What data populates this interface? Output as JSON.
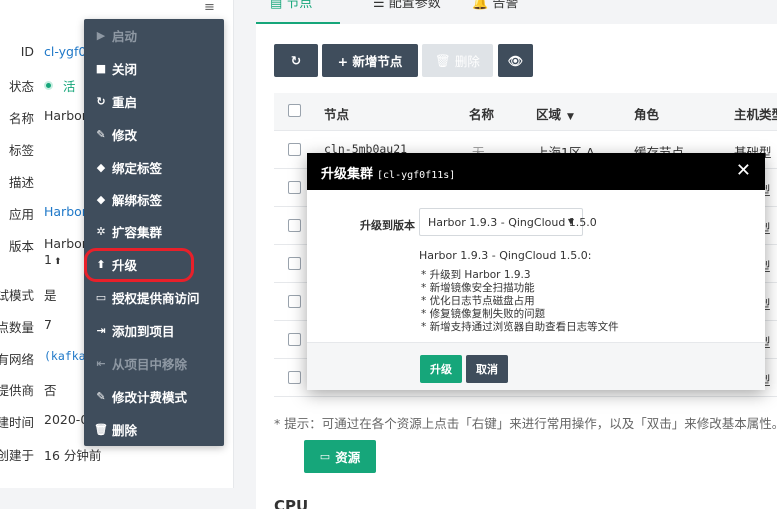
{
  "left_panel": {
    "menu_toggle": "≡",
    "rows": [
      {
        "label": "ID",
        "value": "cl-ygf0"
      },
      {
        "label": "状态",
        "value": "活"
      },
      {
        "label": "名称",
        "value": "Harbor"
      },
      {
        "label": "标签",
        "value": ""
      },
      {
        "label": "描述",
        "value": ""
      },
      {
        "label": "应用",
        "value": "Harbor"
      },
      {
        "label": "版本",
        "value": "Harbor",
        "value2": "1"
      },
      {
        "label": "试模式",
        "value": "是"
      },
      {
        "label": "点数量",
        "value": "7"
      },
      {
        "label": "有网络",
        "value": "(kafka"
      },
      {
        "label": "提供商",
        "value": "否"
      },
      {
        "label": "建时间",
        "value": "2020-0"
      },
      {
        "label": "创建于",
        "value": "16 分钟前"
      }
    ]
  },
  "context_menu": {
    "items": [
      {
        "label": "启动",
        "icon": "play-icon",
        "glyph": "▶",
        "disabled": true
      },
      {
        "label": "关闭",
        "icon": "stop-icon",
        "glyph": "■",
        "disabled": false
      },
      {
        "label": "重启",
        "icon": "restart-icon",
        "glyph": "↻",
        "disabled": false
      },
      {
        "label": "修改",
        "icon": "pencil-icon",
        "glyph": "✎",
        "disabled": false
      },
      {
        "label": "绑定标签",
        "icon": "tag-icon",
        "glyph": "◆",
        "disabled": false
      },
      {
        "label": "解绑标签",
        "icon": "tag-icon",
        "glyph": "◆",
        "disabled": false
      },
      {
        "label": "扩容集群",
        "icon": "gear-icon",
        "glyph": "✲",
        "disabled": false
      },
      {
        "label": "升级",
        "icon": "arrow-up-icon",
        "glyph": "⬆",
        "disabled": false
      },
      {
        "label": "授权提供商访问",
        "icon": "monitor-icon",
        "glyph": "▭",
        "disabled": false
      },
      {
        "label": "添加到项目",
        "icon": "sign-in-icon",
        "glyph": "⇥",
        "disabled": false
      },
      {
        "label": "从项目中移除",
        "icon": "sign-out-icon",
        "glyph": "⇤",
        "disabled": true
      },
      {
        "label": "修改计费模式",
        "icon": "pencil-icon",
        "glyph": "✎",
        "disabled": false
      },
      {
        "label": "删除",
        "icon": "trash-icon",
        "glyph": "🗑",
        "disabled": false
      }
    ]
  },
  "tabs": [
    {
      "label": "节点",
      "icon": "server-icon",
      "active": true
    },
    {
      "label": "配置参数",
      "icon": "list-icon",
      "active": false
    },
    {
      "label": "告警",
      "icon": "bell-icon",
      "active": false
    }
  ],
  "toolbar": {
    "refresh_glyph": "↻",
    "add_node_label": "+ 新增节点",
    "delete_label": "删除",
    "view_glyph": "👁"
  },
  "table": {
    "headers": [
      "节点",
      "名称",
      "区域",
      "角色",
      "主机类型"
    ],
    "rows": [
      {
        "node": "cln-5mb0au21",
        "name": "无",
        "zone": "上海1区-A",
        "role": "缓存节点",
        "type": "基础型"
      },
      {
        "type": "型"
      },
      {
        "type": "型"
      },
      {
        "type": "型"
      },
      {
        "type": "型"
      },
      {
        "type": "型"
      },
      {
        "type": "型"
      }
    ]
  },
  "hint_text": "* 提示：可通过在各个资源上点击「右键」来进行常用操作，以及「双击」来修改基本属性。",
  "resource_button": "资源",
  "section_cpu": "CPU",
  "modal": {
    "title": "升级集群",
    "cluster_id": "[cl-ygf0f11s]",
    "close_glyph": "✕",
    "field_label": "升级到版本",
    "selected_version": "Harbor 1.9.3 - QingCloud 1.5.0",
    "notes_title": "Harbor 1.9.3 - QingCloud 1.5.0:",
    "notes": [
      "* 升级到 Harbor 1.9.3",
      "* 新增镜像安全扫描功能",
      "* 优化日志节点磁盘占用",
      "* 修复镜像复制失败的问题",
      "* 新增支持通过浏览器自助查看日志等文件"
    ],
    "upgrade_button": "升级",
    "cancel_button": "取消"
  },
  "colors": {
    "accent": "#16a67a",
    "menu_bg": "#3f4d5c",
    "highlight": "#e8202a",
    "link": "#1f78c8"
  }
}
